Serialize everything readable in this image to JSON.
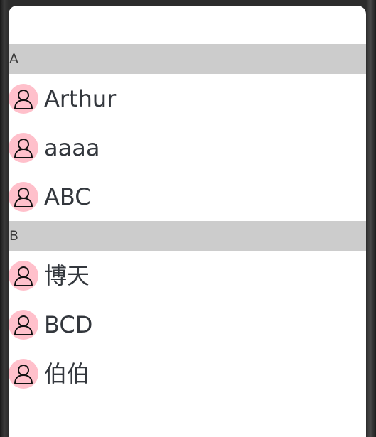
{
  "colors": {
    "section_header_bg": "#cccccc",
    "avatar_bg": "#ffc0cb",
    "text": "#33373d"
  },
  "sections": [
    {
      "letter": "A",
      "contacts": [
        {
          "name": "Arthur",
          "icon": "person-icon"
        },
        {
          "name": "aaaa",
          "icon": "person-icon"
        },
        {
          "name": "ABC",
          "icon": "person-icon"
        }
      ]
    },
    {
      "letter": "B",
      "contacts": [
        {
          "name": "博天",
          "icon": "person-icon"
        },
        {
          "name": "BCD",
          "icon": "person-icon"
        },
        {
          "name": "伯伯",
          "icon": "person-icon"
        }
      ]
    }
  ]
}
